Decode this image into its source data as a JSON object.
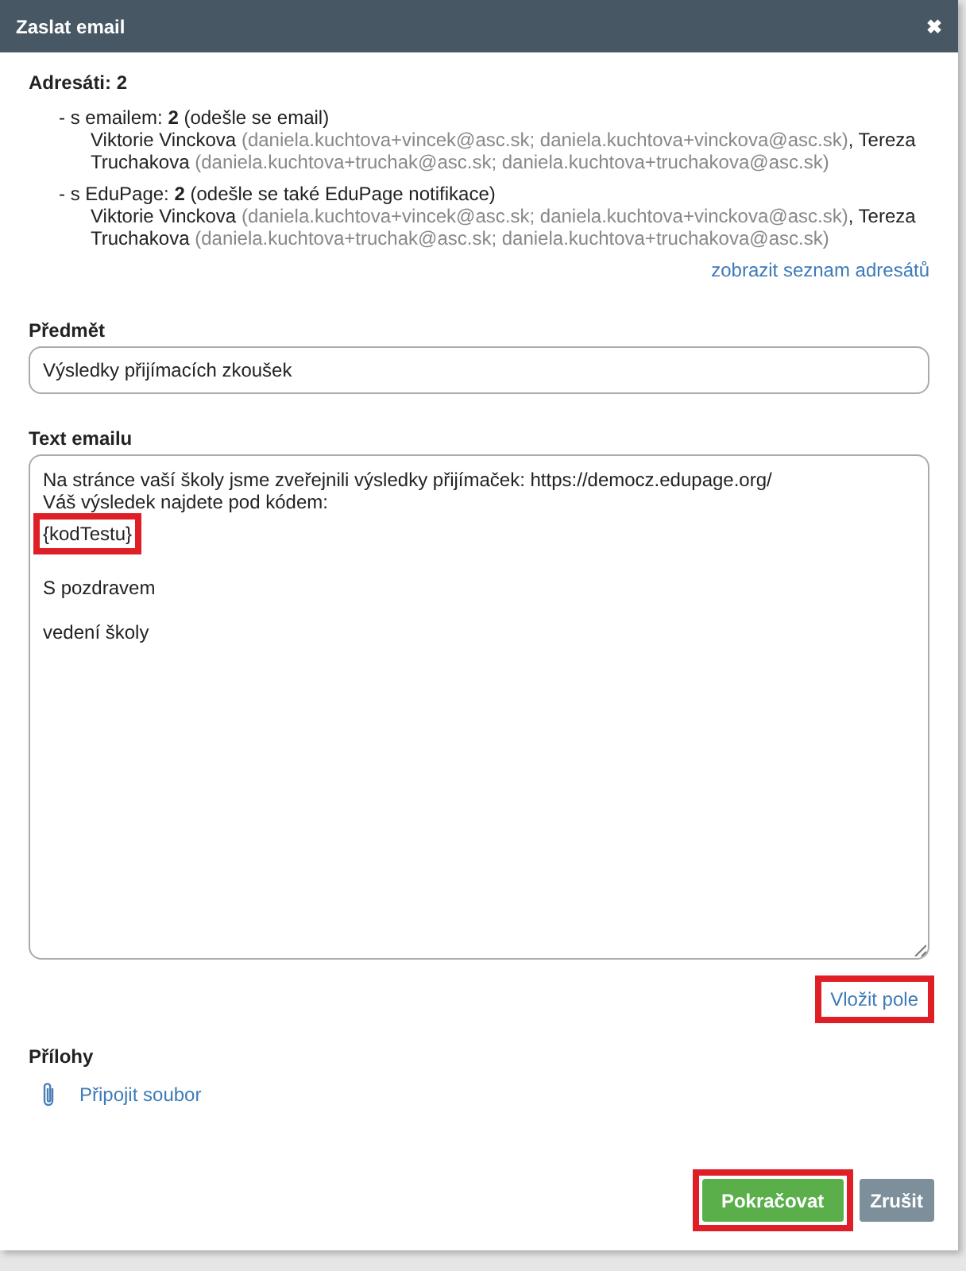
{
  "window": {
    "title": "Zaslat email",
    "close": "✖"
  },
  "recipients": {
    "heading": "Adresáti: 2",
    "groups": [
      {
        "summary": "- s emailem: **2** (odešle se email)",
        "separator": ",",
        "people": [
          {
            "name": "Viktorie Vinckova",
            "emails": "(daniela.kuchtova+vincek@asc.sk; daniela.kuchtova+vinckova@asc.sk)"
          },
          {
            "name": "Tereza Truchakova",
            "emails": "(daniela.kuchtova+truchak@asc.sk; daniela.kuchtova+truchakova@asc.sk)"
          }
        ]
      },
      {
        "summary": "- s EduPage: **2** (odešle se také EduPage notifikace)",
        "separator": ",",
        "people": [
          {
            "name": "Viktorie Vinckova",
            "emails": "(daniela.kuchtova+vincek@asc.sk; daniela.kuchtova+vinckova@asc.sk)"
          },
          {
            "name": "Tereza Truchakova",
            "emails": "(daniela.kuchtova+truchak@asc.sk; daniela.kuchtova+truchakova@asc.sk)"
          }
        ]
      }
    ],
    "show_list_link": "zobrazit seznam adresátů"
  },
  "subject": {
    "label": "Předmět",
    "value": "Výsledky přijímacích zkoušek"
  },
  "body": {
    "label": "Text emailu",
    "paragraphs": [
      {
        "lines": [
          {
            "text": "Na stránce vaší školy jsme zveřejnili výsledky přijímaček: https://democz.edupage.org/",
            "highlighted": false
          },
          {
            "text": "Váš výsledek najdete pod kódem:",
            "highlighted": false
          },
          {
            "text": "{kodTestu}",
            "highlighted": true
          }
        ]
      },
      {
        "lines": [
          {
            "text": "S pozdravem",
            "highlighted": false
          }
        ]
      },
      {
        "lines": [
          {
            "text": "vedení školy",
            "highlighted": false
          }
        ]
      }
    ],
    "insert_field": {
      "label": "Vložit pole",
      "highlighted": true
    }
  },
  "attachments": {
    "label": "Přílohy",
    "attach_link": "Připojit soubor"
  },
  "buttons": [
    {
      "label": "Pokračovat",
      "kind": "primary",
      "highlighted": true
    },
    {
      "label": "Zrušit",
      "kind": "secondary",
      "highlighted": false
    }
  ]
}
